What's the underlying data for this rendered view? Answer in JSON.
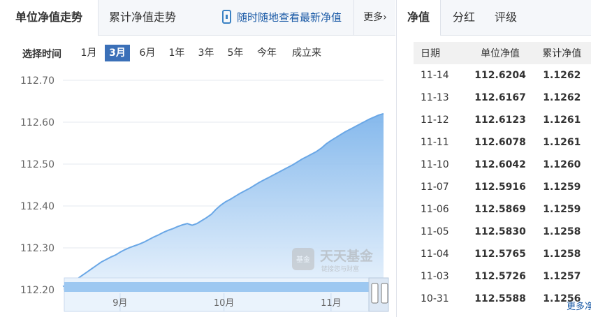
{
  "left_tabs": {
    "unit_nav": "单位净值走势",
    "cumulative_nav": "累计净值走势",
    "mobile_link": "随时随地查看最新净值",
    "more": "更多"
  },
  "range": {
    "label": "选择时间",
    "options": [
      "1月",
      "3月",
      "6月",
      "1年",
      "3年",
      "5年",
      "今年",
      "成立来"
    ],
    "selected": "3月"
  },
  "watermark": {
    "brand": "天天基金",
    "logo_text": "基金",
    "slogan": "链接您与财富"
  },
  "chart_data": {
    "type": "area",
    "ylim": [
      112.2,
      112.7
    ],
    "yticks": [
      "112.70",
      "112.60",
      "112.50",
      "112.40",
      "112.30",
      "112.20"
    ],
    "xticks": [
      {
        "label": "9月",
        "pos": 0.18
      },
      {
        "label": "10月",
        "pos": 0.515
      },
      {
        "label": "11月",
        "pos": 0.86
      }
    ],
    "series": [
      {
        "values": [
          112.208,
          112.212,
          112.218,
          112.226,
          112.234,
          112.242,
          112.25,
          112.258,
          112.266,
          112.272,
          112.278,
          112.283,
          112.29,
          112.296,
          112.301,
          112.305,
          112.309,
          112.314,
          112.32,
          112.326,
          112.331,
          112.337,
          112.342,
          112.346,
          112.351,
          112.355,
          112.358,
          112.354,
          112.358,
          112.365,
          112.372,
          112.38,
          112.392,
          112.402,
          112.41,
          112.416,
          112.423,
          112.43,
          112.436,
          112.442,
          112.449,
          112.456,
          112.462,
          112.468,
          112.474,
          112.48,
          112.486,
          112.492,
          112.498,
          112.505,
          112.512,
          112.518,
          112.524,
          112.53,
          112.538,
          112.548,
          112.556,
          112.563,
          112.57,
          112.577,
          112.583,
          112.589,
          112.595,
          112.601,
          112.607,
          112.612,
          112.617,
          112.6204
        ]
      }
    ],
    "colors": {
      "line": "#6aa7e6",
      "fill_top": "#78b1ea",
      "fill_bottom": "#e6f1fc"
    }
  },
  "nav_panel": {
    "tabs": [
      "净值",
      "分红",
      "评级"
    ],
    "columns": [
      "日期",
      "单位净值",
      "累计净值"
    ],
    "rows": [
      [
        "11-14",
        "112.6204",
        "1.1262"
      ],
      [
        "11-13",
        "112.6167",
        "1.1262"
      ],
      [
        "11-12",
        "112.6123",
        "1.1261"
      ],
      [
        "11-11",
        "112.6078",
        "1.1261"
      ],
      [
        "11-10",
        "112.6042",
        "1.1260"
      ],
      [
        "11-07",
        "112.5916",
        "1.1259"
      ],
      [
        "11-06",
        "112.5869",
        "1.1259"
      ],
      [
        "11-05",
        "112.5830",
        "1.1258"
      ],
      [
        "11-04",
        "112.5765",
        "1.1258"
      ],
      [
        "11-03",
        "112.5726",
        "1.1257"
      ],
      [
        "10-31",
        "112.5588",
        "1.1256"
      ]
    ],
    "more_link": "更多净"
  }
}
